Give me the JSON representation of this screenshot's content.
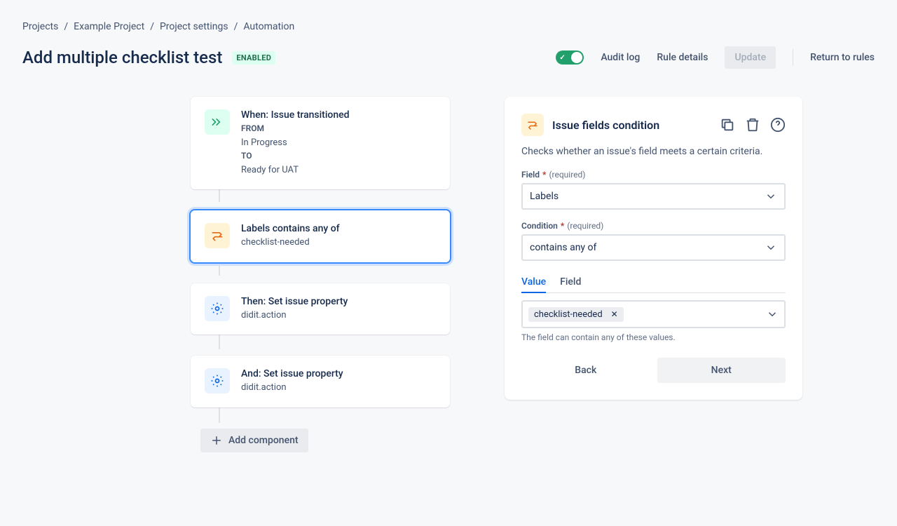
{
  "breadcrumb": {
    "items": [
      "Projects",
      "Example Project",
      "Project settings",
      "Automation"
    ]
  },
  "header": {
    "title": "Add multiple checklist test",
    "status": "ENABLED",
    "audit_log": "Audit log",
    "rule_details": "Rule details",
    "update": "Update",
    "return": "Return to rules"
  },
  "flow": {
    "trigger": {
      "title": "When: Issue transitioned",
      "from_label": "FROM",
      "from_value": "In Progress",
      "to_label": "TO",
      "to_value": "Ready for UAT"
    },
    "condition": {
      "title": "Labels contains any of",
      "sub": "checklist-needed"
    },
    "action1": {
      "title": "Then: Set issue property",
      "sub": "didit.action"
    },
    "action2": {
      "title": "And: Set issue property",
      "sub": "didit.action"
    },
    "add_component": "Add component"
  },
  "panel": {
    "title": "Issue fields condition",
    "description": "Checks whether an issue's field meets a certain criteria.",
    "field_label": "Field",
    "required": "(required)",
    "field_value": "Labels",
    "condition_label": "Condition",
    "condition_value": "contains any of",
    "tab_value": "Value",
    "tab_field": "Field",
    "chip": "checklist-needed",
    "help": "The field can contain any of these values.",
    "back": "Back",
    "next": "Next"
  }
}
